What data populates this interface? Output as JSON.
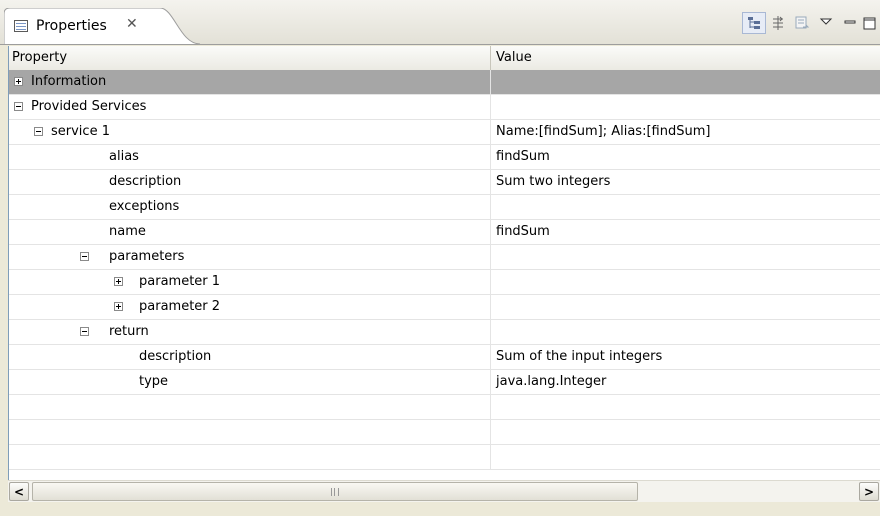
{
  "view": {
    "tab_title": "Properties",
    "tab_close_glyph": "✕",
    "icons": [
      "properties-view-icon",
      "categories-icon",
      "filter-advanced-icon",
      "restore-default-icon",
      "view-menu-icon",
      "minimize-icon",
      "maximize-icon"
    ]
  },
  "table": {
    "columns": {
      "property": "Property",
      "value": "Value"
    },
    "rows": [
      {
        "label": "Information",
        "value": "",
        "level": 0,
        "expander": "plus",
        "selected": true
      },
      {
        "label": "Provided Services",
        "value": "",
        "level": 0,
        "expander": "minus"
      },
      {
        "label": "service 1",
        "value": "Name:[findSum]; Alias:[findSum]",
        "level": 1,
        "expander": "minus"
      },
      {
        "label": "alias",
        "value": "findSum",
        "level": 2,
        "expander": ""
      },
      {
        "label": "description",
        "value": "Sum two integers",
        "level": 2,
        "expander": ""
      },
      {
        "label": "exceptions",
        "value": "",
        "level": 2,
        "expander": ""
      },
      {
        "label": "name",
        "value": "findSum",
        "level": 2,
        "expander": ""
      },
      {
        "label": "parameters",
        "value": "",
        "level": 2,
        "expander": "minus"
      },
      {
        "label": "parameter 1",
        "value": "",
        "level": 3,
        "expander": "plus"
      },
      {
        "label": "parameter 2",
        "value": "",
        "level": 3,
        "expander": "plus"
      },
      {
        "label": "return",
        "value": "",
        "level": 2,
        "expander": "minus"
      },
      {
        "label": "description",
        "value": "Sum of the input integers",
        "level": 3,
        "expander": ""
      },
      {
        "label": "type",
        "value": "java.lang.Integer",
        "level": 3,
        "expander": ""
      }
    ],
    "empty_rows": 3
  },
  "scrollbar": {
    "left_arrow": "<",
    "right_arrow": ">"
  }
}
